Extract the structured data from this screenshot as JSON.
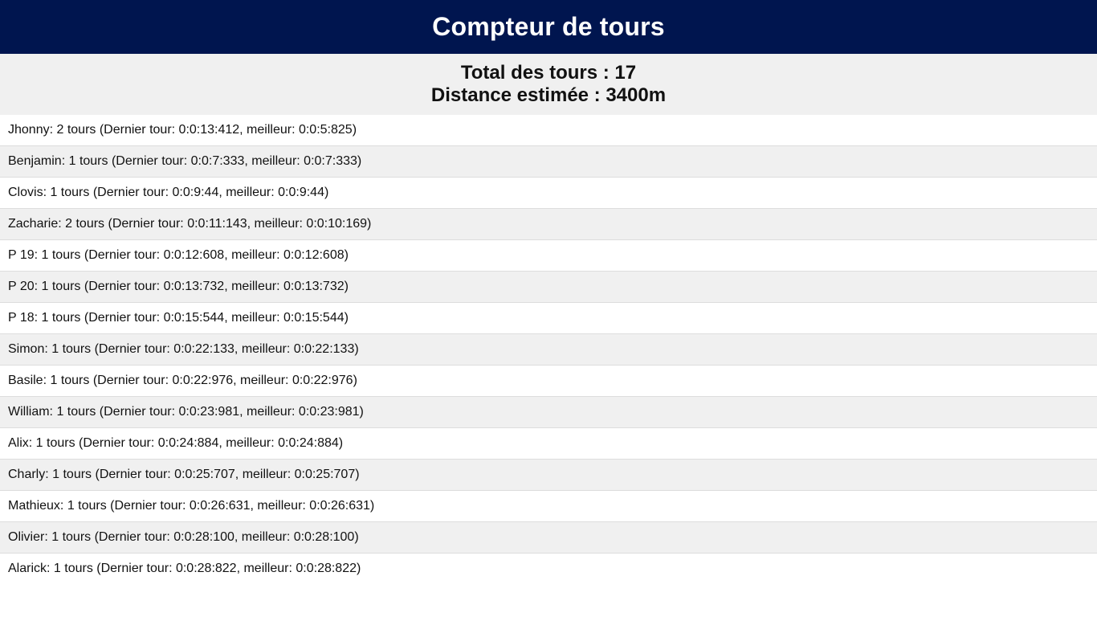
{
  "header": {
    "title": "Compteur de tours"
  },
  "summary": {
    "total_laps": "Total des tours : 17",
    "distance": "Distance estimée : 3400m"
  },
  "runners": [
    "Jhonny: 2 tours (Dernier tour: 0:0:13:412, meilleur: 0:0:5:825)",
    "Benjamin: 1 tours (Dernier tour: 0:0:7:333, meilleur: 0:0:7:333)",
    "Clovis: 1 tours (Dernier tour: 0:0:9:44, meilleur: 0:0:9:44)",
    "Zacharie: 2 tours (Dernier tour: 0:0:11:143, meilleur: 0:0:10:169)",
    "P 19: 1 tours (Dernier tour: 0:0:12:608, meilleur: 0:0:12:608)",
    "P 20: 1 tours (Dernier tour: 0:0:13:732, meilleur: 0:0:13:732)",
    "P 18: 1 tours (Dernier tour: 0:0:15:544, meilleur: 0:0:15:544)",
    "Simon: 1 tours (Dernier tour: 0:0:22:133, meilleur: 0:0:22:133)",
    "Basile: 1 tours (Dernier tour: 0:0:22:976, meilleur: 0:0:22:976)",
    "William: 1 tours (Dernier tour: 0:0:23:981, meilleur: 0:0:23:981)",
    "Alix: 1 tours (Dernier tour: 0:0:24:884, meilleur: 0:0:24:884)",
    "Charly: 1 tours (Dernier tour: 0:0:25:707, meilleur: 0:0:25:707)",
    "Mathieux: 1 tours (Dernier tour: 0:0:26:631, meilleur: 0:0:26:631)",
    "Olivier: 1 tours (Dernier tour: 0:0:28:100, meilleur: 0:0:28:100)",
    "Alarick: 1 tours (Dernier tour: 0:0:28:822, meilleur: 0:0:28:822)"
  ],
  "colors": {
    "header_bg": "#00154f",
    "row_alt_bg": "#f0f0f0"
  }
}
